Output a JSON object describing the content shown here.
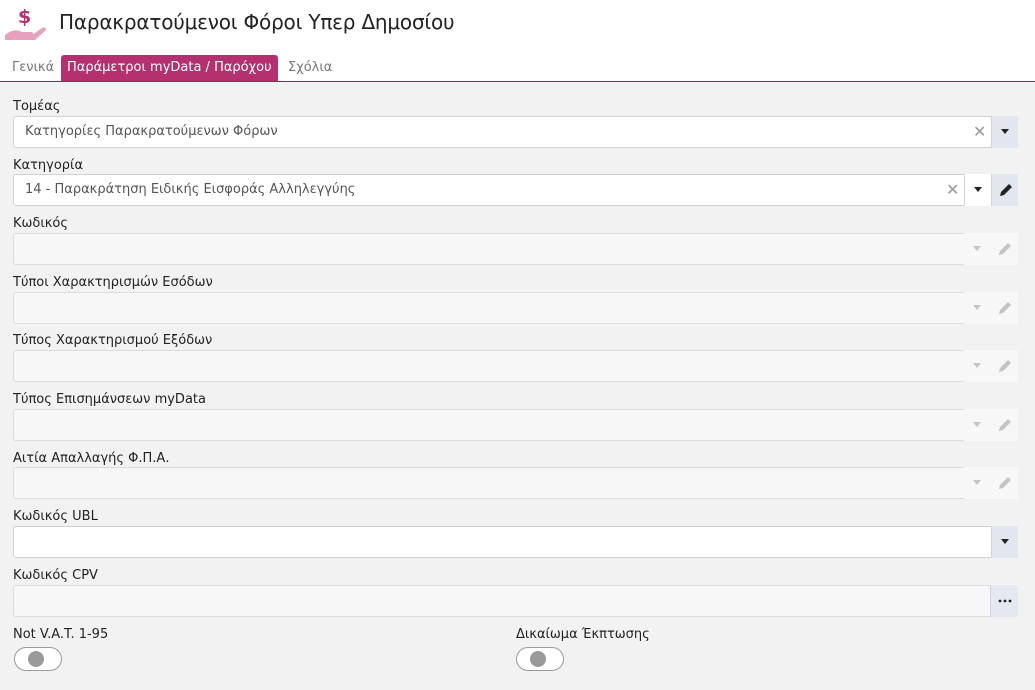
{
  "header": {
    "title": "Παρακρατούμενοι Φόροι Υπερ Δημοσίου",
    "icon": "hand-dollar-icon"
  },
  "tabs": [
    {
      "label": "Γενικά",
      "active": false
    },
    {
      "label": "Παράμετροι myData / Παρόχου",
      "active": true
    },
    {
      "label": "Σχόλια",
      "active": false
    }
  ],
  "fields": {
    "sector": {
      "label": "Τομέας",
      "value": "Κατηγορίες Παρακρατούμενων Φόρων"
    },
    "category": {
      "label": "Κατηγορία",
      "value": "14 - Παρακράτηση Ειδικής Εισφοράς Αλληλεγγύης"
    },
    "code": {
      "label": "Κωδικός",
      "value": ""
    },
    "income_types": {
      "label": "Τύποι Χαρακτηρισμών Εσόδων",
      "value": ""
    },
    "expense_type": {
      "label": "Τύπος Χαρακτηρισμού Εξόδων",
      "value": ""
    },
    "mydata_notes": {
      "label": "Τύπος Επισημάνσεων myData",
      "value": ""
    },
    "vat_exemption": {
      "label": "Αιτία Απαλλαγής Φ.Π.Α.",
      "value": ""
    },
    "ubl_code": {
      "label": "Κωδικός UBL",
      "value": ""
    },
    "cpv_code": {
      "label": "Κωδικός CPV",
      "value": ""
    }
  },
  "toggles": {
    "not_vat": {
      "label": "Not V.A.T. 1-95",
      "on": false
    },
    "deduction_right": {
      "label": "Δικαίωμα Έκπτωσης",
      "on": false
    }
  },
  "colors": {
    "accent": "#b4306e",
    "accent_line": "#9c1f59",
    "icon_pink": "#e8a1bd"
  }
}
